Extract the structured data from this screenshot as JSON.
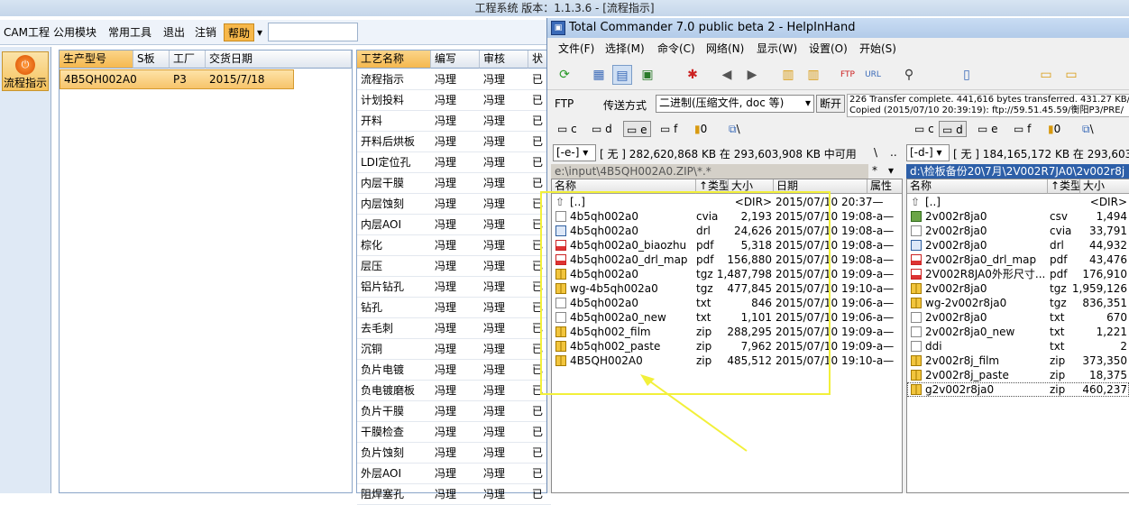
{
  "app": {
    "title": "工程系统  版本：1.1.3.6 - [流程指示]",
    "menu": [
      "CAM工程",
      "公用模块",
      "常用工具",
      "退出",
      "注销",
      "帮助"
    ],
    "flow_button": "流程指示"
  },
  "job_grid": {
    "headers": [
      "生产型号",
      "S板",
      "工厂",
      "交货日期"
    ],
    "row": {
      "model": "4B5QH002A0",
      "s": "",
      "factory": "P3",
      "date": "2015/7/18"
    }
  },
  "process_grid": {
    "headers": [
      "工艺名称",
      "编写",
      "审核",
      "状"
    ],
    "rows": [
      [
        "流程指示",
        "冯理",
        "冯理",
        "已"
      ],
      [
        "计划投料",
        "冯理",
        "冯理",
        "已"
      ],
      [
        "开料",
        "冯理",
        "冯理",
        "已"
      ],
      [
        "开料后烘板",
        "冯理",
        "冯理",
        "已"
      ],
      [
        "LDI定位孔",
        "冯理",
        "冯理",
        "已"
      ],
      [
        "内层干膜",
        "冯理",
        "冯理",
        "已"
      ],
      [
        "内层蚀刻",
        "冯理",
        "冯理",
        "已"
      ],
      [
        "内层AOI",
        "冯理",
        "冯理",
        "已"
      ],
      [
        "棕化",
        "冯理",
        "冯理",
        "已"
      ],
      [
        "层压",
        "冯理",
        "冯理",
        "已"
      ],
      [
        "铝片钻孔",
        "冯理",
        "冯理",
        "已"
      ],
      [
        "钻孔",
        "冯理",
        "冯理",
        "已"
      ],
      [
        "去毛刺",
        "冯理",
        "冯理",
        "已"
      ],
      [
        "沉铜",
        "冯理",
        "冯理",
        "已"
      ],
      [
        "负片电镀",
        "冯理",
        "冯理",
        "已"
      ],
      [
        "负电镀磨板",
        "冯理",
        "冯理",
        "已"
      ],
      [
        "负片干膜",
        "冯理",
        "冯理",
        "已"
      ],
      [
        "干膜检查",
        "冯理",
        "冯理",
        "已"
      ],
      [
        "负片蚀刻",
        "冯理",
        "冯理",
        "已"
      ],
      [
        "外层AOI",
        "冯理",
        "冯理",
        "已"
      ],
      [
        "阻焊塞孔",
        "冯理",
        "冯理",
        "已"
      ]
    ]
  },
  "tc": {
    "title": "Total Commander 7.0 public beta 2 - HelpInHand",
    "menu": [
      "文件(F)",
      "选择(M)",
      "命令(C)",
      "网络(N)",
      "显示(W)",
      "设置(O)",
      "开始(S)"
    ],
    "ftp_label": "FTP",
    "transfer_label": "传送方式",
    "transfer_mode": "二进制(压缩文件, doc 等)",
    "disconnect": "断开",
    "log_line1": "226 Transfer complete. 441,616 bytes transferred. 431.27 KB/sec",
    "log_line2": "Copied (2015/07/10 20:39:19): ftp://59.51.45.59/衡阳P3/PRE/",
    "left_drives": [
      "c",
      "d",
      "e",
      "f",
      "0",
      "\\"
    ],
    "right_drives": [
      "c",
      "d",
      "e",
      "f",
      "0",
      "\\"
    ],
    "left_drive_combo": "[-e-]",
    "left_info": "[ 无 ]  282,620,868 KB 在 293,603,908 KB 中可用",
    "right_drive_combo": "[-d-]",
    "right_info": "[ 无 ]  184,165,172 KB 在 293,603,",
    "left_path": "e:\\input\\4B5QH002A0.ZIP\\*.*",
    "right_path": "d:\\检板备份20\\7月\\2V002R7JA0\\2v002r8j",
    "path_star": "*",
    "path_back": "\\",
    "path_up": "..",
    "left_headers": [
      "名称",
      "↑类型",
      "大小",
      "日期",
      "属性"
    ],
    "right_headers": [
      "名称",
      "↑类型",
      "大小"
    ],
    "left_files": [
      {
        "name": "[..]",
        "ext": "",
        "size": "<DIR>",
        "date": "2015/07/10 20:37—",
        "icon": "up"
      },
      {
        "name": "4b5qh002a0",
        "ext": "cvia",
        "size": "2,193",
        "date": "2015/07/10 19:08-a—",
        "icon": "file"
      },
      {
        "name": "4b5qh002a0",
        "ext": "drl",
        "size": "24,626",
        "date": "2015/07/10 19:08-a—",
        "icon": "drl"
      },
      {
        "name": "4b5qh002a0_biaozhu",
        "ext": "pdf",
        "size": "5,318",
        "date": "2015/07/10 19:08-a—",
        "icon": "pdf"
      },
      {
        "name": "4b5qh002a0_drl_map",
        "ext": "pdf",
        "size": "156,880",
        "date": "2015/07/10 19:08-a—",
        "icon": "pdf"
      },
      {
        "name": "4b5qh002a0",
        "ext": "tgz",
        "size": "1,487,798",
        "date": "2015/07/10 19:09-a—",
        "icon": "zip"
      },
      {
        "name": "wg-4b5qh002a0",
        "ext": "tgz",
        "size": "477,845",
        "date": "2015/07/10 19:10-a—",
        "icon": "zip"
      },
      {
        "name": "4b5qh002a0",
        "ext": "txt",
        "size": "846",
        "date": "2015/07/10 19:06-a—",
        "icon": "file"
      },
      {
        "name": "4b5qh002a0_new",
        "ext": "txt",
        "size": "1,101",
        "date": "2015/07/10 19:06-a—",
        "icon": "file"
      },
      {
        "name": "4b5qh002_film",
        "ext": "zip",
        "size": "288,295",
        "date": "2015/07/10 19:09-a—",
        "icon": "zip"
      },
      {
        "name": "4b5qh002_paste",
        "ext": "zip",
        "size": "7,962",
        "date": "2015/07/10 19:09-a—",
        "icon": "zip"
      },
      {
        "name": "4B5QH002A0",
        "ext": "zip",
        "size": "485,512",
        "date": "2015/07/10 19:10-a—",
        "icon": "zip"
      }
    ],
    "right_files": [
      {
        "name": "[..]",
        "ext": "",
        "size": "<DIR>",
        "icon": "up"
      },
      {
        "name": "2v002r8ja0",
        "ext": "csv",
        "size": "1,494",
        "icon": "csv"
      },
      {
        "name": "2v002r8ja0",
        "ext": "cvia",
        "size": "33,791",
        "icon": "file"
      },
      {
        "name": "2v002r8ja0",
        "ext": "drl",
        "size": "44,932",
        "icon": "drl"
      },
      {
        "name": "2v002r8ja0_drl_map",
        "ext": "pdf",
        "size": "43,476",
        "icon": "pdf"
      },
      {
        "name": "2V002R8JA0外形尺寸...",
        "ext": "pdf",
        "size": "176,910",
        "icon": "pdf"
      },
      {
        "name": "2v002r8ja0",
        "ext": "tgz",
        "size": "1,959,126",
        "icon": "zip"
      },
      {
        "name": "wg-2v002r8ja0",
        "ext": "tgz",
        "size": "836,351",
        "icon": "zip"
      },
      {
        "name": "2v002r8ja0",
        "ext": "txt",
        "size": "670",
        "icon": "file"
      },
      {
        "name": "2v002r8ja0_new",
        "ext": "txt",
        "size": "1,221",
        "icon": "file"
      },
      {
        "name": "ddi",
        "ext": "txt",
        "size": "2",
        "icon": "file"
      },
      {
        "name": "2v002r8j_film",
        "ext": "zip",
        "size": "373,350",
        "icon": "zip"
      },
      {
        "name": "2v002r8j_paste",
        "ext": "zip",
        "size": "18,375",
        "icon": "zip"
      },
      {
        "name": "g2v002r8ja0",
        "ext": "zip",
        "size": "460,237",
        "icon": "zip"
      }
    ]
  },
  "colors": {
    "highlight_box": "#f2f03a",
    "selected_row": "#f7c46a",
    "process_header": "#f7c46a"
  }
}
